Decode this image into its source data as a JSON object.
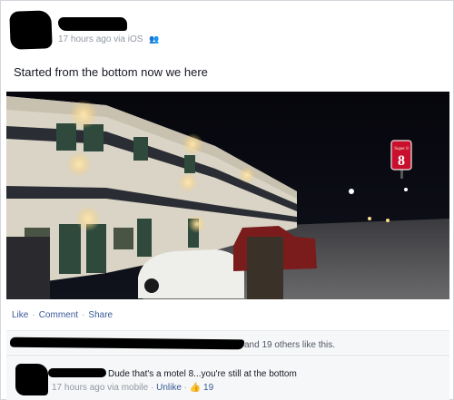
{
  "post": {
    "timestamp": "17 hours ago via iOS",
    "privacy_icon": "people-icon",
    "status_text": "Started from the bottom now we here"
  },
  "actions": {
    "like": "Like",
    "comment": "Comment",
    "share": "Share",
    "separator": "·"
  },
  "likes": {
    "text": "and 19 others like this."
  },
  "comment": {
    "text": "Dude that's a motel 8...you're still at the bottom",
    "timestamp": "17 hours ago via mobile",
    "unlike": "Unlike",
    "like_count": "19",
    "like_icon": "thumbs-up-icon",
    "separator": "·"
  },
  "photo": {
    "sign_brand": "Super 8",
    "sign_number": "8"
  },
  "colors": {
    "link": "#3b5998",
    "meta": "#9197a3",
    "sign_red": "#c8102e"
  }
}
